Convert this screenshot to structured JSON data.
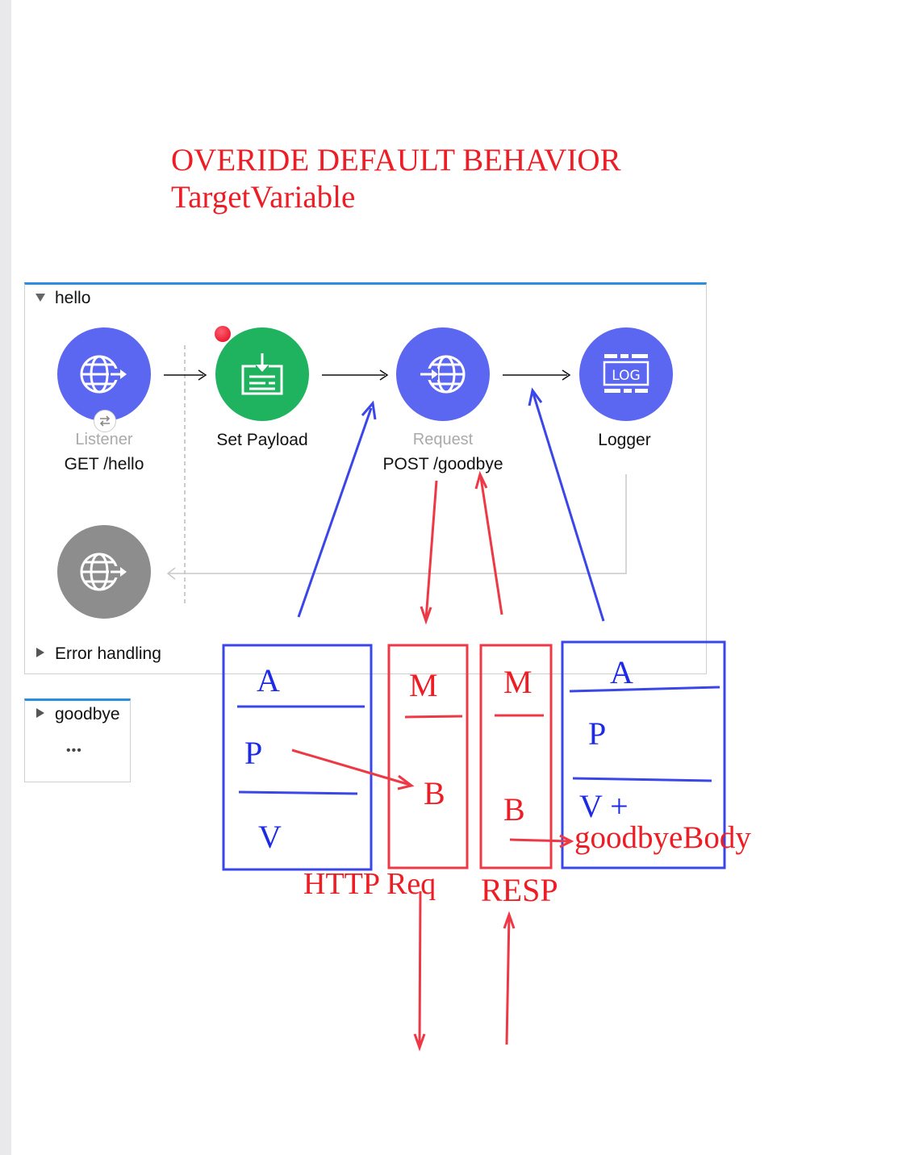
{
  "annotation": {
    "title_line1": "OVERIDE DEFAULT BEHAVIOR",
    "title_line2": "TargetVariable"
  },
  "flows": {
    "hello": {
      "name": "hello",
      "nodes": [
        {
          "sub": "Listener",
          "main": "GET /hello",
          "icon": "globe-inbound-icon"
        },
        {
          "sub": "",
          "main": "Set Payload",
          "icon": "set-payload-icon"
        },
        {
          "sub": "Request",
          "main": "POST /goodbye",
          "icon": "globe-request-icon"
        },
        {
          "sub": "",
          "main": "Logger",
          "icon": "log-icon"
        }
      ],
      "error_handling": "Error handling",
      "logger_icon_text": "LOG"
    },
    "goodbye": {
      "name": "goodbye",
      "more": "•••"
    }
  },
  "handwriting": {
    "box1": {
      "a": "A",
      "p": "P",
      "v": "V"
    },
    "box2": {
      "m": "M",
      "b": "B",
      "label": "HTTP Req"
    },
    "box3": {
      "m": "M",
      "b": "B",
      "label": "RESP"
    },
    "box4": {
      "a": "A",
      "p": "P",
      "v": "V +",
      "target": "goodbyeBody"
    }
  },
  "colors": {
    "annotation_red": "#ee1c24",
    "annotation_blue": "#1d2ae6",
    "flow_accent": "#2b8de0",
    "node_blue": "#5b67f1",
    "node_green": "#1fb35f"
  }
}
